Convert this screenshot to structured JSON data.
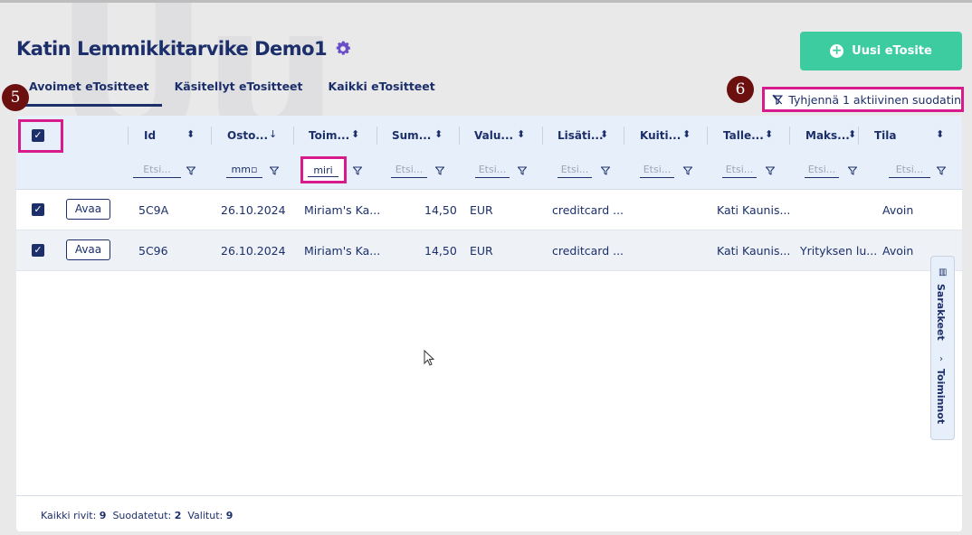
{
  "header": {
    "title": "Katin Lemmikkitarvike Demo1",
    "new_button": "Uusi eTosite"
  },
  "tabs": [
    {
      "label": "Avoimet eTositteet",
      "active": true
    },
    {
      "label": "Käsitellyt eTositteet",
      "active": false
    },
    {
      "label": "Kaikki eTositteet",
      "active": false
    }
  ],
  "clear_filter": "Tyhjennä 1 aktiivinen suodatin",
  "badges": {
    "five": "5",
    "six": "6"
  },
  "columns": [
    {
      "label": "Id",
      "filter": "Etsi..."
    },
    {
      "label": "Osto...",
      "filter": "mm"
    },
    {
      "label": "Toim...",
      "filter": "miri"
    },
    {
      "label": "Sum...",
      "filter": "Etsi..."
    },
    {
      "label": "Valu...",
      "filter": "Etsi..."
    },
    {
      "label": "Lisäti...",
      "filter": "Etsi..."
    },
    {
      "label": "Kuiti...",
      "filter": "Etsi..."
    },
    {
      "label": "Talle...",
      "filter": "Etsi..."
    },
    {
      "label": "Maks...",
      "filter": "Etsi..."
    },
    {
      "label": "Tila",
      "filter": "Etsi..."
    }
  ],
  "rows": [
    {
      "open": "Avaa",
      "id": "5C9A",
      "date": "26.10.2024",
      "vendor": "Miriam's Ka...",
      "sum": "14,50",
      "currency": "EUR",
      "extra": "creditcard ...",
      "receipt": "",
      "saver": "Kati Kaunis...",
      "payment": "",
      "status": "Avoin"
    },
    {
      "open": "Avaa",
      "id": "5C96",
      "date": "26.10.2024",
      "vendor": "Miriam's Ka...",
      "sum": "14,50",
      "currency": "EUR",
      "extra": "creditcard ...",
      "receipt": "",
      "saver": "Kati Kaunis...",
      "payment": "Yrityksen lu...",
      "status": "Avoin"
    }
  ],
  "side_panel": {
    "columns": "Sarakkeet",
    "actions": "Toiminnot"
  },
  "footer": {
    "all_label": "Kaikki rivit:",
    "all_value": "9",
    "filtered_label": "Suodatetut:",
    "filtered_value": "2",
    "selected_label": "Valitut:",
    "selected_value": "9"
  },
  "colors": {
    "accent": "#3dcca0",
    "primary": "#1c2f6b",
    "highlight": "#d81b8c"
  }
}
